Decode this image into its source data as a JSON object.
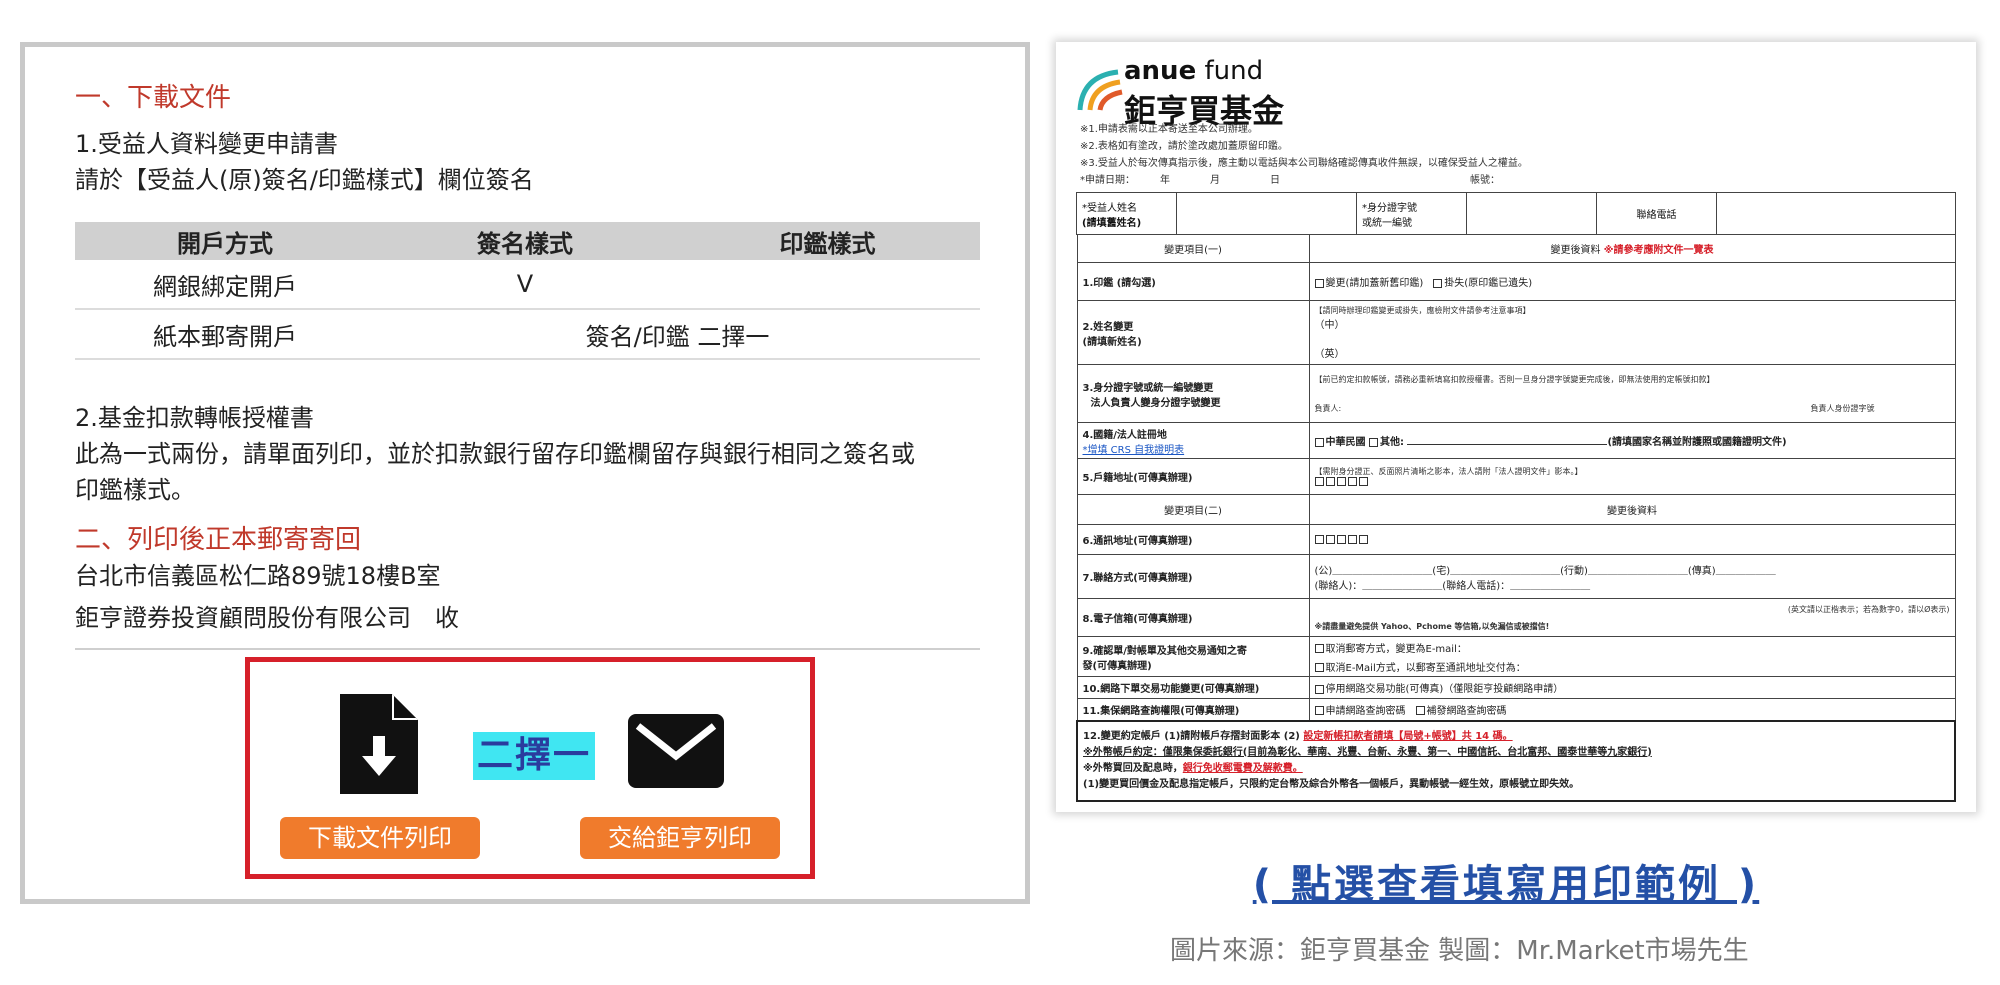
{
  "left": {
    "section1_title": "一、下載文件",
    "item1_title": "1.受益人資料變更申請書",
    "item1_desc": "請於【受益人(原)簽名/印鑑樣式】欄位簽名",
    "table": {
      "headers": [
        "開戶方式",
        "簽名樣式",
        "印鑑樣式"
      ],
      "rows": [
        {
          "method": "網銀綁定開戶",
          "sign": "V",
          "seal": ""
        },
        {
          "method": "紙本郵寄開戶",
          "merged": "簽名/印鑑 二擇一"
        }
      ]
    },
    "item2_title": "2.基金扣款轉帳授權書",
    "item2_desc_line1": "此為一式兩份，請單面列印，並於扣款銀行留存印鑑欄留存與銀行相同之簽名或",
    "item2_desc_line2": "印鑑樣式。",
    "section2_title": "二、列印後正本郵寄寄回",
    "address": "台北市信義區松仁路89號18樓B室",
    "recipient": "鉅亨證券投資顧問股份有限公司　收",
    "choice": {
      "badge": "二擇一",
      "download_btn": "下載文件列印",
      "mail_btn": "交給鉅亨列印",
      "download_icon": "document-download-icon",
      "mail_icon": "envelope-icon"
    }
  },
  "form": {
    "logo_en_bold": "anue",
    "logo_en_rest": " fund",
    "logo_zh": "鉅亨買基金",
    "notes": [
      "※1.申請表需以正本寄送至本公司辦理。",
      "※2.表格如有塗改，請於塗改處加蓋原留印鑑。",
      "※3.受益人於每次傳真指示後，應主動以電話與本公司聯絡確認傳真收件無誤，以確保受益人之權益。",
      "*申請日期：　　　年　　　　月　　　　　日　　　　　　　　　　　　　　　　　　　帳號："
    ],
    "row_name": {
      "a": "*受益人姓名",
      "a2": "(請填舊姓名)",
      "b": "*身分證字號",
      "b2": "或統一編號",
      "c": "聯絡電話"
    },
    "hdr1": {
      "left": "變更項目(一)",
      "right": "變更後資料",
      "right_note": "※請參考應附文件一覽表"
    },
    "r1": {
      "label": "1.印鑑 (請勾選)",
      "opt1": "變更(請加蓋新舊印鑑)",
      "opt2": "掛失(原印鑑已遺失)"
    },
    "r2": {
      "label": "2.姓名變更",
      "label2": "(請填新姓名)",
      "note": "【請同時辦理印鑑變更或掛失，應檢附文件請參考注意事項】",
      "zh": "（中）",
      "en": "（英）"
    },
    "r3": {
      "label": "3.身分證字號或統一編號變更",
      "label2": "法人負責人變身分證字號變更",
      "note": "【前已約定扣款帳號，請務必重新填寫扣款授權書。否則一旦身分證字號變更完成後，即無法使用約定帳號扣款】",
      "s1": "負責人:",
      "s2": "負責人身份證字號"
    },
    "r4": {
      "label": "4.國籍/法人註冊地",
      "label2": "*增填 CRS 自我證明表",
      "opt1": "中華民國",
      "opt2": "其他:",
      "note": "(請填國家名稱並附護照或國籍證明文件)"
    },
    "r5": {
      "label": "5.戶籍地址(可傳真辦理)",
      "note": "【需附身分證正、反面照片清晰之影本，法人請附「法人證明文件」影本。】"
    },
    "hdr2": {
      "left": "變更項目(二)",
      "right": "變更後資料"
    },
    "r6": {
      "label": "6.通訊地址(可傳真辦理)"
    },
    "r7": {
      "label": "7.聯絡方式(可傳真辦理)",
      "line1": "(公)＿＿＿＿＿＿＿＿＿＿(宅)＿＿＿＿＿＿＿＿＿＿＿(行動)＿＿＿＿＿＿＿＿＿＿(傳真)＿＿＿＿＿＿",
      "line2": "(聯絡人)：＿＿＿＿＿＿＿＿(聯絡人電話)：＿＿＿＿＿＿＿＿"
    },
    "r8": {
      "label": "8.電子信箱(可傳真辦理)",
      "note1": "(英文請以正楷表示；若為數字0，請以Ø表示)",
      "note2": "※請盡量避免提供 Yahoo、Pchome 等信箱,以免漏信或被擋信!"
    },
    "r9": {
      "label": "9.確認單/對帳單及其他交易通知之寄",
      "label2": "發(可傳真辦理)",
      "opt1": "取消郵寄方式，變更為E-mail：",
      "opt2": "取消E-Mail方式，以郵寄至通訊地址交付為："
    },
    "r10": {
      "label": "10.網路下單交易功能變更(可傳真辦理)",
      "opt": "停用網路交易功能(可傳真)（僅限鉅亨投顧網路申請）"
    },
    "r11": {
      "label": "11.集保網路查詢權限(可傳真辦理)",
      "opt1": "申請網路查詢密碼",
      "opt2": "補發網路查詢密碼"
    },
    "r12": {
      "line1": "12.變更約定帳戶 (1)請附帳戶存摺封面影本 (2)",
      "line1_red": "設定新帳扣款者請填【局號+帳號】共 14 碼。",
      "line2": "※外幣帳戶約定：僅限集保委託銀行(目前為彰化、華南、兆豐、台新、永豐、第一、中國信託、台北富邦、國泰世華等九家銀行)",
      "line3": "※外幣買回及配息時，",
      "line3_red": "銀行免收郵電費及解款費。",
      "line4": "(1)變更買回價金及配息指定帳戶，只限約定台幣及綜合外幣各一個帳戶，異動帳號一經生效，原帳號立即失效。"
    }
  },
  "view_link": "( 點選查看填寫用印範例 )",
  "source": "圖片來源：鉅亨買基金 製圖：Mr.Market市場先生",
  "colors": {
    "section_red": "#c0392b",
    "box_red": "#d6202a",
    "orange": "#f07b2c",
    "cyan": "#40e6f2",
    "link_blue": "#2450a6"
  }
}
